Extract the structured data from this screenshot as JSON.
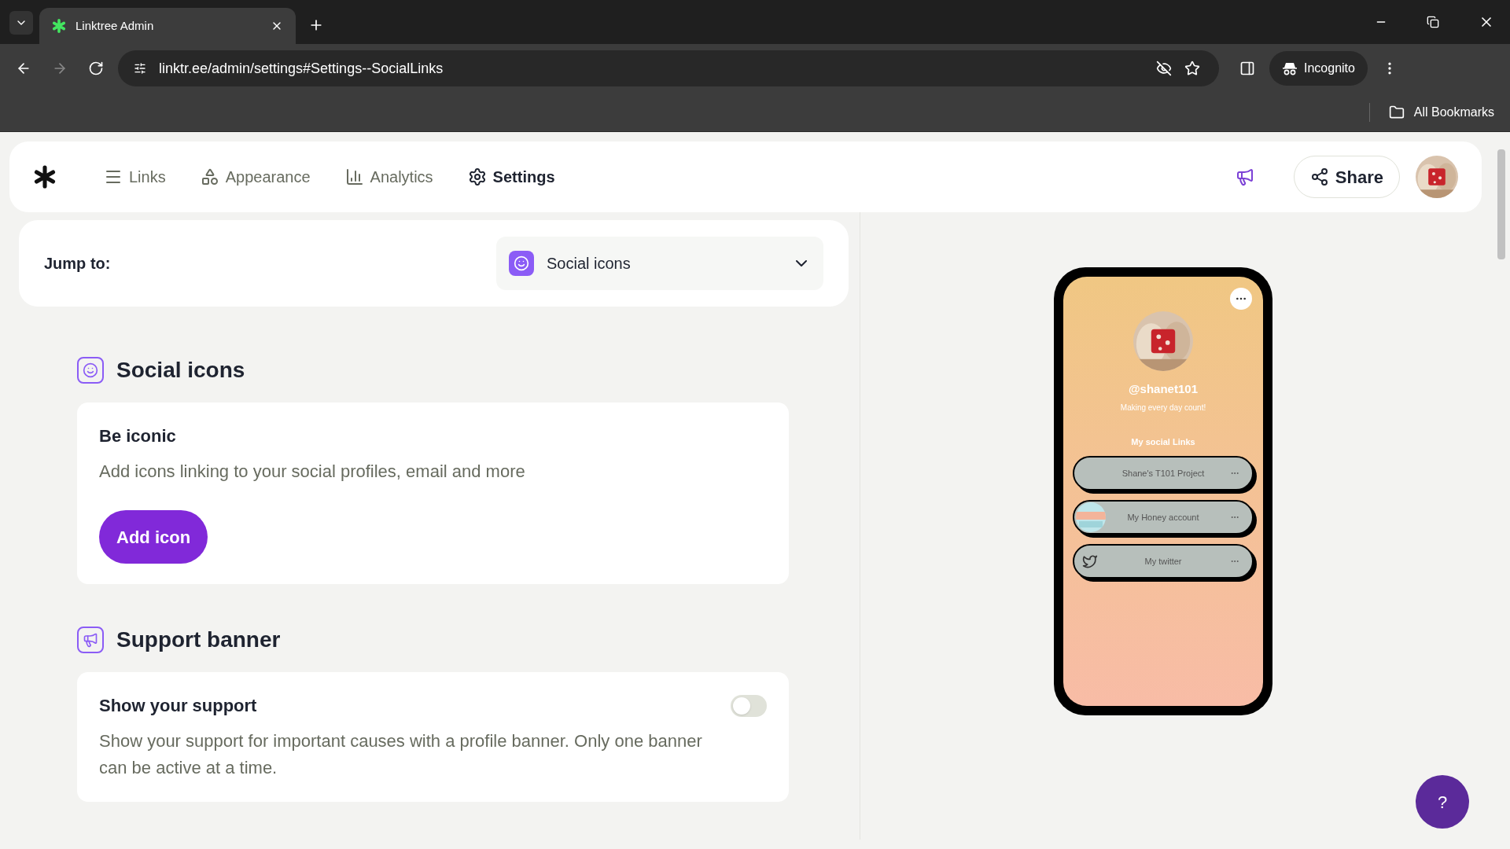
{
  "browser": {
    "tab_title": "Linktree Admin",
    "url": "linktr.ee/admin/settings#Settings--SocialLinks",
    "profile": "Incognito",
    "bookmarks": "All Bookmarks"
  },
  "nav": {
    "items": [
      {
        "label": "Links",
        "selected": false
      },
      {
        "label": "Appearance",
        "selected": false
      },
      {
        "label": "Analytics",
        "selected": false
      },
      {
        "label": "Settings",
        "selected": true
      }
    ],
    "share": "Share"
  },
  "jump_to": {
    "label": "Jump to:",
    "value": "Social icons"
  },
  "sections": [
    {
      "kind": "social",
      "title": "Social icons",
      "card_title": "Be iconic",
      "description": "Add icons linking to your social profiles, email and more",
      "button": "Add icon"
    },
    {
      "kind": "banner",
      "title": "Support banner",
      "card_title": "Show your support",
      "description": "Show your support for important causes with a profile banner. Only one banner can be active at a time.",
      "on": false
    }
  ],
  "preview": {
    "username": "@shanet101",
    "bio": "Making every day count!",
    "heading": "My social Links",
    "links": [
      {
        "title": "Shane's T101 Project",
        "kind": "plain"
      },
      {
        "title": "My Honey account",
        "kind": "picture"
      },
      {
        "title": "My twitter",
        "kind": "twitter"
      }
    ]
  },
  "help": "?"
}
